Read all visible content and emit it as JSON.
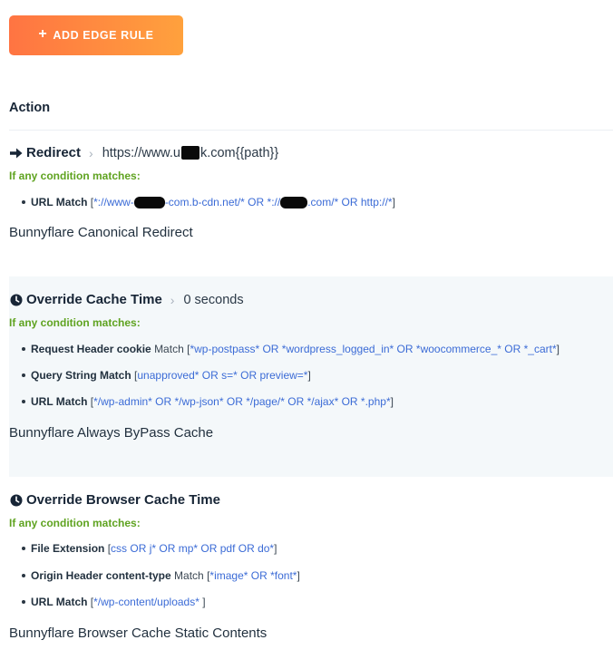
{
  "toolbar": {
    "add_rule_label": "ADD EDGE RULE",
    "add_rule_icon": "plus-icon",
    "accent_start": "#ff7442",
    "accent_end": "#ffa13d"
  },
  "section": {
    "title": "Action"
  },
  "rules": [
    {
      "icon": "arrow-right-icon",
      "name": "Redirect",
      "value_prefix": "https://www.u",
      "value_suffix": "k.com{{path}}",
      "condition_label": "If any condition matches:",
      "conditions": [
        {
          "key": "URL Match",
          "match": "",
          "value_prefix": "*://www-",
          "value_mid": "-com.b-cdn.net/* OR *://",
          "value_mid2": "",
          "value_suffix": ".com/* OR http://*"
        }
      ],
      "description": "Bunnyflare Canonical Redirect"
    },
    {
      "icon": "clock-icon",
      "name": "Override Cache Time",
      "value": "0 seconds",
      "condition_label": "If any condition matches:",
      "conditions": [
        {
          "key": "Request Header cookie",
          "match": "Match",
          "value": "*wp-postpass* OR *wordpress_logged_in* OR *woocommerce_* OR *_cart*"
        },
        {
          "key": "Query String Match",
          "match": "",
          "value": "unapproved* OR s=* OR preview=*"
        },
        {
          "key": "URL Match",
          "match": "",
          "value": "*/wp-admin* OR */wp-json* OR */page/* OR */ajax* OR *.php*"
        }
      ],
      "description": "Bunnyflare Always ByPass Cache"
    },
    {
      "icon": "clock-icon",
      "name": "Override Browser Cache Time",
      "condition_label": "If any condition matches:",
      "conditions": [
        {
          "key": "File Extension",
          "match": "",
          "value": "css OR j* OR mp* OR pdf OR do*"
        },
        {
          "key": "Origin Header content-type",
          "match": "Match",
          "value": "*image* OR *font*"
        },
        {
          "key": "URL Match",
          "match": "",
          "value": "*/wp-content/uploads* "
        }
      ],
      "description": "Bunnyflare Browser Cache Static Contents"
    }
  ]
}
